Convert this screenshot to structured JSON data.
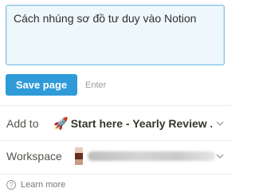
{
  "title_input": {
    "value": "Cách nhúng sơ đồ tư duy vào Notion"
  },
  "actions": {
    "save_label": "Save page",
    "enter_hint": "Enter"
  },
  "add_to": {
    "label": "Add to",
    "icon": "rocket-icon",
    "value": "Start here - Yearly Review ..."
  },
  "workspace": {
    "label": "Workspace",
    "value_obscured": true
  },
  "footer": {
    "learn_more_label": "Learn more",
    "icon": "help-icon"
  },
  "colors": {
    "accent": "#2e9bd8",
    "input_border": "#7fbfe2",
    "input_bg": "#eef7fb"
  }
}
